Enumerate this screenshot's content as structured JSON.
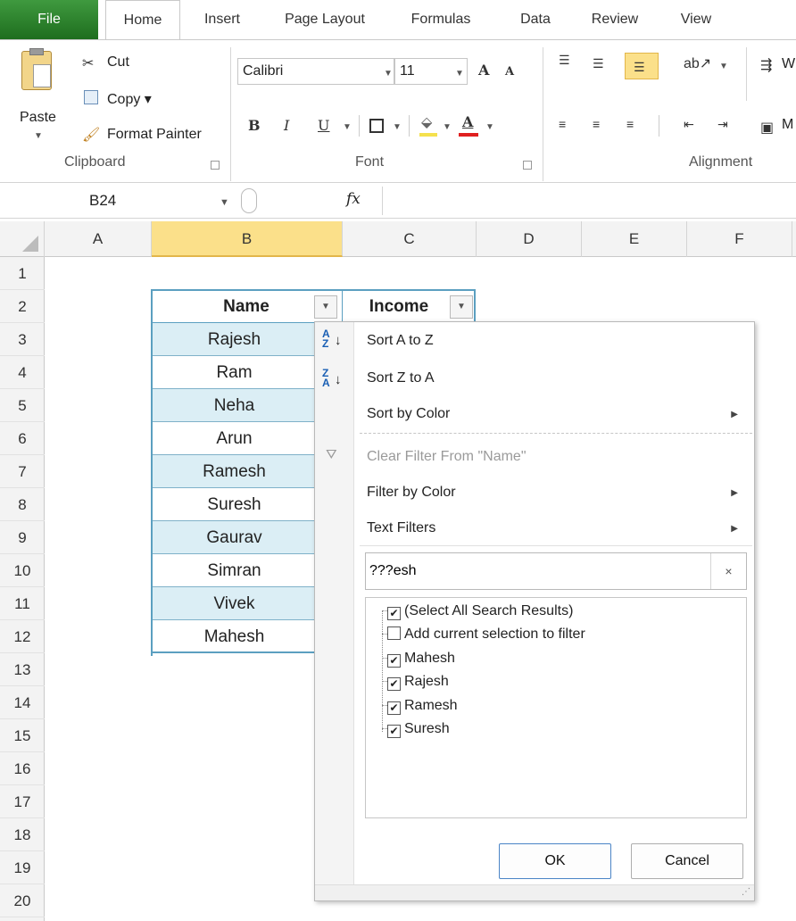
{
  "ribbon_tabs": [
    "File",
    "Home",
    "Insert",
    "Page Layout",
    "Formulas",
    "Data",
    "Review",
    "View"
  ],
  "clipboard": {
    "cut": "Cut",
    "copy": "Copy ▾",
    "paste": "Paste",
    "format_painter": "Format Painter",
    "group_label": "Clipboard"
  },
  "font": {
    "name": "Calibri",
    "size": "11",
    "group_label": "Font",
    "bold": "B",
    "italic": "I",
    "underline": "U",
    "grow": "A",
    "shrink": "A"
  },
  "alignment": {
    "group_label": "Alignment",
    "wrap_partial": "W",
    "merge_partial": "M"
  },
  "formula_bar": {
    "name_box": "B24",
    "fx": "fx",
    "value": ""
  },
  "columns": [
    "A",
    "B",
    "C",
    "D",
    "E",
    "F"
  ],
  "rows": [
    "1",
    "2",
    "3",
    "4",
    "5",
    "6",
    "7",
    "8",
    "9",
    "10",
    "11",
    "12",
    "13",
    "14",
    "15",
    "16",
    "17",
    "18",
    "19",
    "20"
  ],
  "table": {
    "headers": [
      "Name",
      "Income"
    ],
    "names": [
      "Rajesh",
      "Ram",
      "Neha",
      "Arun",
      "Ramesh",
      "Suresh",
      "Gaurav",
      "Simran",
      "Vivek",
      "Mahesh"
    ]
  },
  "filter_menu": {
    "sort_az": "Sort A to Z",
    "sort_za": "Sort Z to A",
    "sort_by_color": "Sort by Color",
    "clear_filter": "Clear Filter From \"Name\"",
    "filter_by_color": "Filter by Color",
    "text_filters": "Text Filters",
    "search_value": "???esh",
    "clear_search": "×",
    "list": [
      {
        "label": "(Select All Search Results)",
        "checked": true
      },
      {
        "label": "Add current selection to filter",
        "checked": false
      },
      {
        "label": "Mahesh",
        "checked": true
      },
      {
        "label": "Rajesh",
        "checked": true
      },
      {
        "label": "Ramesh",
        "checked": true
      },
      {
        "label": "Suresh",
        "checked": true
      }
    ],
    "ok": "OK",
    "cancel": "Cancel"
  },
  "colors": {
    "band": "#dbeef5",
    "table_border": "#5b9fc0",
    "selected_col": "#fbe08a",
    "file_tab": "#2a7d2a"
  }
}
